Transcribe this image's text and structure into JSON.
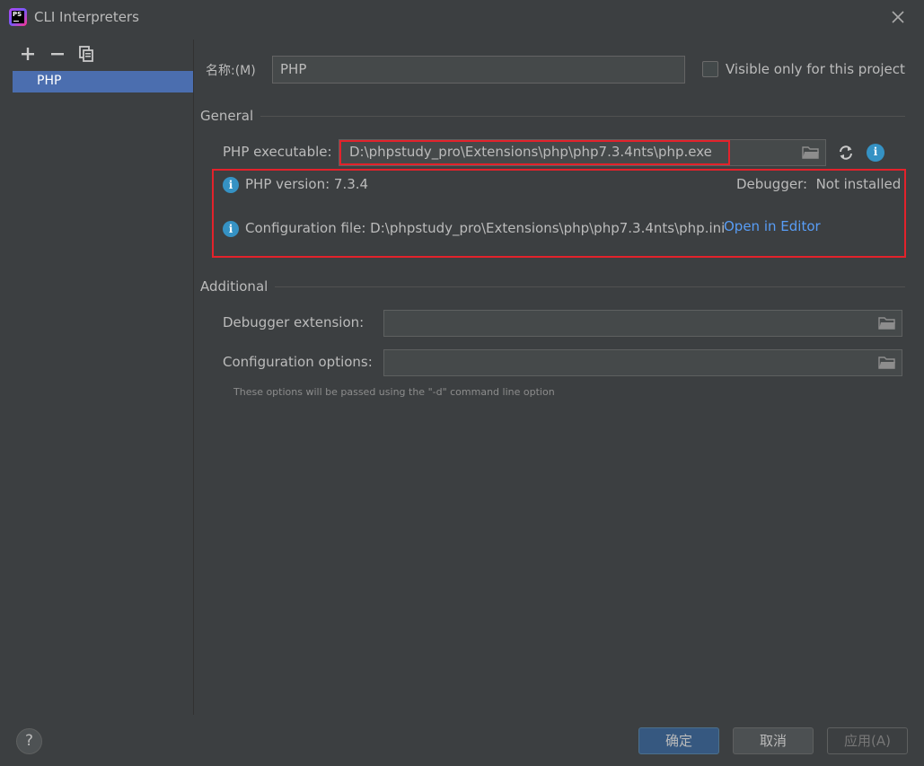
{
  "window": {
    "title": "CLI Interpreters",
    "app_icon": "phpstorm-logo",
    "app_icon_text": "PS"
  },
  "toolbar": {
    "add_icon": "plus-icon",
    "remove_icon": "minus-icon",
    "copy_icon": "copy-icon"
  },
  "interpreters": {
    "items": [
      {
        "label": "PHP",
        "selected": true
      }
    ]
  },
  "form": {
    "name_label": "名称:(M)",
    "name_value": "PHP",
    "visible_only_label": "Visible only for this project",
    "visible_only_checked": false
  },
  "general": {
    "section_title": "General",
    "executable_label": "PHP executable:",
    "executable_value": "D:\\phpstudy_pro\\Extensions\\php\\php7.3.4nts\\php.exe",
    "php_version": "PHP version: 7.3.4",
    "debugger_status": "Debugger:  Not installed",
    "config_file": "Configuration file: D:\\phpstudy_pro\\Extensions\\php\\php7.3.4nts\\php.ini",
    "open_in_editor": "Open in Editor"
  },
  "additional": {
    "section_title": "Additional",
    "debugger_ext_label": "Debugger extension:",
    "debugger_ext_value": "",
    "config_options_label": "Configuration options:",
    "config_options_value": "",
    "hint": "These options will be passed using the \"-d\" command line option"
  },
  "buttons": {
    "help": "?",
    "ok": "确定",
    "cancel": "取消",
    "apply": "应用(A)"
  },
  "colors": {
    "background": "#3c3f41",
    "selection": "#4b6eaf",
    "highlight_border": "#e3222b",
    "link": "#589df6",
    "info_icon": "#3592c4",
    "ok_button": "#365880"
  }
}
